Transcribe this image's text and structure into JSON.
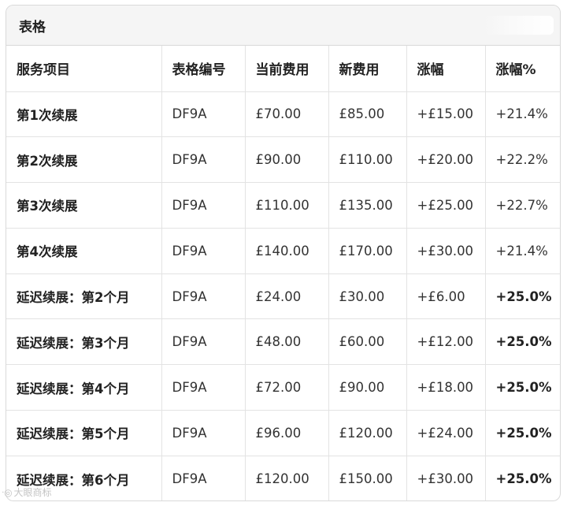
{
  "card": {
    "title": "表格"
  },
  "table": {
    "headers": [
      "服务项目",
      "表格编号",
      "当前费用",
      "新费用",
      "涨幅",
      "涨幅%"
    ],
    "rows": [
      {
        "item": "第1次续展",
        "form": "DF9A",
        "current": "£70.00",
        "new": "£85.00",
        "increase": "+£15.00",
        "percent": "+21.4%",
        "percent_bold": false
      },
      {
        "item": "第2次续展",
        "form": "DF9A",
        "current": "£90.00",
        "new": "£110.00",
        "increase": "+£20.00",
        "percent": "+22.2%",
        "percent_bold": false
      },
      {
        "item": "第3次续展",
        "form": "DF9A",
        "current": "£110.00",
        "new": "£135.00",
        "increase": "+£25.00",
        "percent": "+22.7%",
        "percent_bold": false
      },
      {
        "item": "第4次续展",
        "form": "DF9A",
        "current": "£140.00",
        "new": "£170.00",
        "increase": "+£30.00",
        "percent": "+21.4%",
        "percent_bold": false
      },
      {
        "item": "延迟续展：第2个月",
        "form": "DF9A",
        "current": "£24.00",
        "new": "£30.00",
        "increase": "+£6.00",
        "percent": "+25.0%",
        "percent_bold": true
      },
      {
        "item": "延迟续展：第3个月",
        "form": "DF9A",
        "current": "£48.00",
        "new": "£60.00",
        "increase": "+£12.00",
        "percent": "+25.0%",
        "percent_bold": true
      },
      {
        "item": "延迟续展：第4个月",
        "form": "DF9A",
        "current": "£72.00",
        "new": "£90.00",
        "increase": "+£18.00",
        "percent": "+25.0%",
        "percent_bold": true
      },
      {
        "item": "延迟续展：第5个月",
        "form": "DF9A",
        "current": "£96.00",
        "new": "£120.00",
        "increase": "+£24.00",
        "percent": "+25.0%",
        "percent_bold": true
      },
      {
        "item": "延迟续展：第6个月",
        "form": "DF9A",
        "current": "£120.00",
        "new": "£150.00",
        "increase": "+£30.00",
        "percent": "+25.0%",
        "percent_bold": true
      }
    ]
  },
  "watermark": {
    "text": "大眼商标",
    "icon": "watermark-logo-icon"
  }
}
